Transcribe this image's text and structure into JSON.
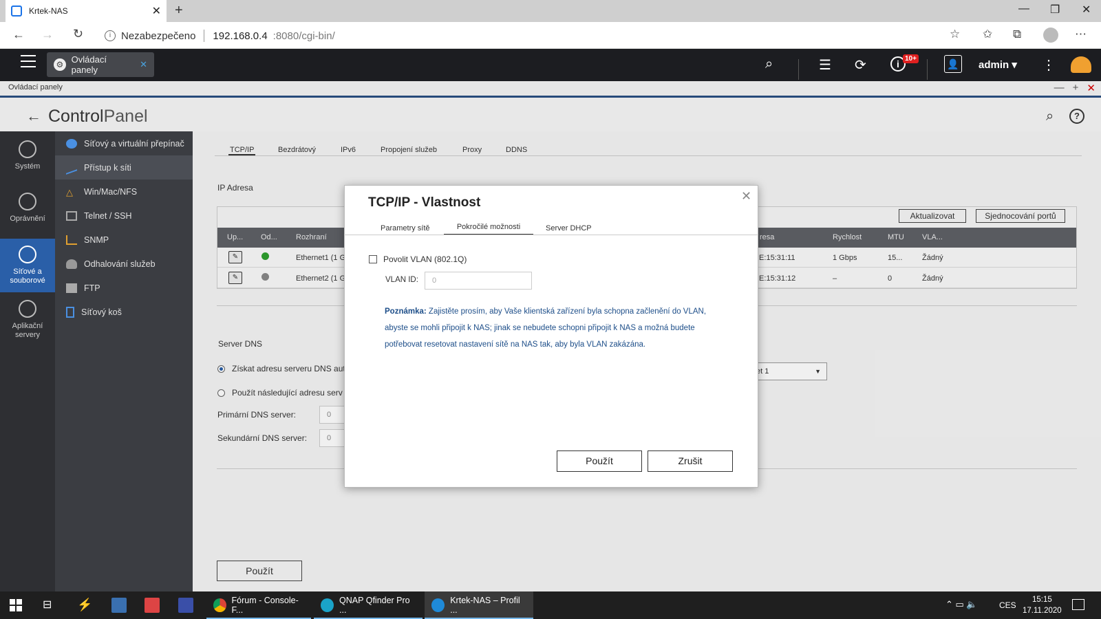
{
  "browser": {
    "tab_title": "Krtek-NAS",
    "address_security": "Nezabezpečeno",
    "address_host": "192.168.0.4",
    "address_path": ":8080/cgi-bin/"
  },
  "qnap_top": {
    "app_tab_label": "Ovládací panely",
    "badge": "10+",
    "user": "admin"
  },
  "window_title": "Ovládací panely",
  "header": {
    "title_bold": "Control",
    "title_light": "Panel"
  },
  "rail": [
    {
      "label": "Systém",
      "icon": "gear-icon"
    },
    {
      "label": "Oprávnění",
      "icon": "user-icon"
    },
    {
      "label": "Síťové a souborové",
      "icon": "globe-icon",
      "selected": true
    },
    {
      "label": "Aplikační servery",
      "icon": "apps-icon"
    }
  ],
  "submenu": [
    {
      "label": "Síťový a virtuální přepínač",
      "icon": "network-switch-icon",
      "color": "#4a90e2"
    },
    {
      "label": "Přístup k síti",
      "icon": "network-access-icon",
      "color": "#4a90e2",
      "selected": true
    },
    {
      "label": "Win/Mac/NFS",
      "icon": "triangle-icon",
      "color": "#e0a030"
    },
    {
      "label": "Telnet / SSH",
      "icon": "terminal-icon",
      "color": "#aaaaaa"
    },
    {
      "label": "SNMP",
      "icon": "chart-icon",
      "color": "#e0a030"
    },
    {
      "label": "Odhalování služeb",
      "icon": "discovery-icon",
      "color": "#999999"
    },
    {
      "label": "FTP",
      "icon": "folder-icon",
      "color": "#aaaaaa"
    },
    {
      "label": "Síťový koš",
      "icon": "recycle-bin-icon",
      "color": "#4a90e2"
    }
  ],
  "tabs": [
    "TCP/IP",
    "Bezdrátový",
    "IPv6",
    "Propojení služeb",
    "Proxy",
    "DDNS"
  ],
  "ip_section": {
    "title": "IP Adresa",
    "update_button": "Aktualizovat",
    "ports_button": "Sjednocování portů",
    "columns": [
      "Up...",
      "Od...",
      "Rozhraní",
      "resa",
      "Rychlost",
      "MTU",
      "VLA..."
    ],
    "rows": [
      {
        "status_color": "#2ea02e",
        "iface": "Ethernet1 (1 G",
        "mac": ":E:15:31:11",
        "speed": "1 Gbps",
        "mtu": "15...",
        "vlan": "Žádný"
      },
      {
        "status_color": "#888888",
        "iface": "Ethernet2 (1 G",
        "mac": ":E:15:31:12",
        "speed": "–",
        "mtu": "0",
        "vlan": "Žádný"
      }
    ]
  },
  "dns": {
    "title": "Server DNS",
    "opt_auto": "Získat adresu serveru DNS aut",
    "opt_manual": "Použít následující adresu serv",
    "primary_label": "Primární DNS server:",
    "secondary_label": "Sekundární DNS server:",
    "primary_value": "0",
    "secondary_value": "0",
    "select_value": "et 1"
  },
  "main_apply": "Použít",
  "modal": {
    "title": "TCP/IP - Vlastnost",
    "tabs": [
      "Parametry sítě",
      "Pokročilé možnosti",
      "Server DHCP"
    ],
    "vlan_checkbox": "Povolit VLAN (802.1Q)",
    "vlan_id_label": "VLAN ID:",
    "vlan_id_placeholder": "0",
    "note_label": "Poznámka:",
    "note_line1": " Zajistěte prosím, aby Vaše klientská zařízení byla schopna začlenění do VLAN,",
    "note_line2": "abyste se mohli připojit k NAS; jinak se nebudete schopni připojit k NAS a možná budete",
    "note_line3": "potřebovat resetovat nastavení sítě na NAS tak, aby byla VLAN zakázána.",
    "apply": "Použít",
    "cancel": "Zrušit"
  },
  "taskbar": {
    "apps": [
      {
        "label": "Fórum - Console-F..."
      },
      {
        "label": "QNAP Qfinder Pro ..."
      },
      {
        "label": "Krtek-NAS – Profil ..."
      }
    ],
    "lang": "CES",
    "time": "15:15",
    "date": "17.11.2020"
  }
}
